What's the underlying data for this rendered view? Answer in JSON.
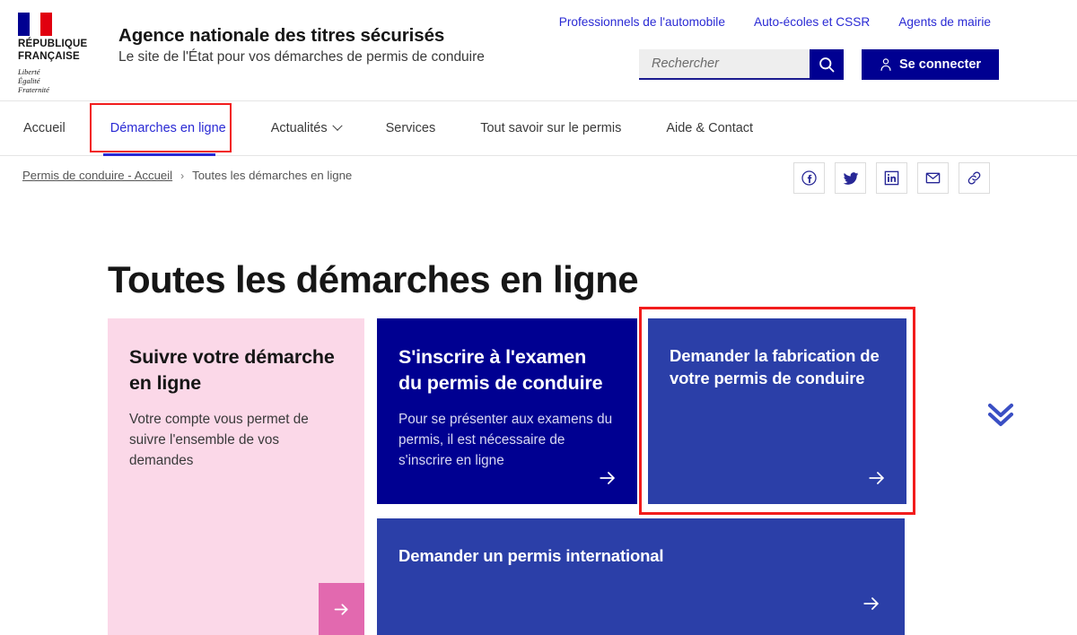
{
  "colors": {
    "brand_blue": "#000091",
    "link_blue": "#2a2ad4",
    "card_blue": "#2B3FA8",
    "card_pink": "#FBD8E8",
    "pink_accent": "#E269AF",
    "flag_red": "#E1000F",
    "highlight_red": "#f21c1c",
    "text_dark": "#161616"
  },
  "header": {
    "logo": {
      "republic_line1": "RÉPUBLIQUE",
      "republic_line2": "FRANÇAISE",
      "motto_line1": "Liberté",
      "motto_line2": "Égalité",
      "motto_line3": "Fraternité"
    },
    "site_title": "Agence nationale des titres sécurisés",
    "site_tagline": "Le site de l'État pour vos démarches de permis de conduire",
    "top_links": [
      {
        "label": "Professionnels de l'automobile"
      },
      {
        "label": "Auto-écoles et CSSR"
      },
      {
        "label": "Agents de mairie"
      }
    ],
    "search": {
      "placeholder": "Rechercher",
      "value": "",
      "icon": "search-icon"
    },
    "login": {
      "label": "Se connecter",
      "icon": "user-icon"
    }
  },
  "nav": {
    "items": [
      {
        "label": "Accueil",
        "active": false,
        "has_dropdown": false
      },
      {
        "label": "Démarches en ligne",
        "active": true,
        "has_dropdown": false
      },
      {
        "label": "Actualités",
        "active": false,
        "has_dropdown": true
      },
      {
        "label": "Services",
        "active": false,
        "has_dropdown": false
      },
      {
        "label": "Tout savoir sur le permis",
        "active": false,
        "has_dropdown": false
      },
      {
        "label": "Aide & Contact",
        "active": false,
        "has_dropdown": false
      }
    ]
  },
  "breadcrumb": {
    "home": "Permis de conduire - Accueil",
    "separator": "›",
    "current": "Toutes les démarches en ligne"
  },
  "share": {
    "buttons": [
      {
        "name": "facebook-icon",
        "title": "Facebook"
      },
      {
        "name": "twitter-icon",
        "title": "Twitter"
      },
      {
        "name": "linkedin-icon",
        "title": "LinkedIn"
      },
      {
        "name": "mail-icon",
        "title": "Email"
      },
      {
        "name": "link-icon",
        "title": "Copier le lien"
      }
    ]
  },
  "main": {
    "page_title": "Toutes les démarches en ligne",
    "cards": [
      {
        "title": "Suivre votre démarche en ligne",
        "description": "Votre compte vous permet de suivre l'ensemble de vos demandes",
        "theme": "pink",
        "has_arrow_button": true
      },
      {
        "title": "S'inscrire à l'examen du permis de conduire",
        "description": "Pour se présenter aux examens du permis, il est nécessaire de s'inscrire en ligne",
        "theme": "navy",
        "has_arrow_button": true
      },
      {
        "title": "Demander la fabrication de votre permis de conduire",
        "description": "",
        "theme": "blue",
        "highlighted": true,
        "has_arrow_button": true
      },
      {
        "title": "Demander un permis international",
        "description": "",
        "theme": "blue-wide",
        "has_arrow_button": true
      }
    ],
    "scroll_indicator": {
      "name": "double-chevron-down-icon"
    }
  }
}
